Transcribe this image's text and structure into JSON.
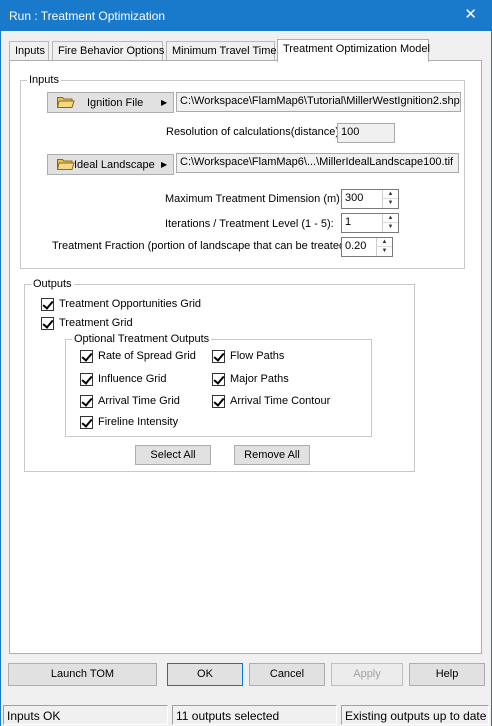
{
  "window": {
    "title": "Run : Treatment Optimization",
    "close_glyph": "✕"
  },
  "tabs": [
    {
      "label": "Inputs"
    },
    {
      "label": "Fire Behavior Options"
    },
    {
      "label": "Minimum Travel Time"
    },
    {
      "label": "Treatment Optimization Model"
    }
  ],
  "inputs": {
    "legend": "Inputs",
    "ignition_button": "Ignition File",
    "ignition_path": "C:\\Workspace\\FlamMap6\\Tutorial\\MillerWestIgnition2.shp",
    "resolution_label": "Resolution of calculations(distance):",
    "resolution_value": "100",
    "landscape_button": "Ideal Landscape",
    "landscape_path": "C:\\Workspace\\FlamMap6\\...\\MillerIdealLandscape100.tif",
    "max_dim_label": "Maximum Treatment Dimension (m):",
    "max_dim_value": "300",
    "iterations_label": "Iterations / Treatment Level (1 - 5):",
    "iterations_value": "1",
    "fraction_label": "Treatment Fraction (portion of landscape that can be treated):",
    "fraction_value": "0.20"
  },
  "outputs": {
    "legend": "Outputs",
    "opportunities": "Treatment Opportunities Grid",
    "treatment_grid": "Treatment Grid",
    "optional_legend": "Optional Treatment Outputs",
    "rate_of_spread": "Rate of Spread Grid",
    "influence": "Influence Grid",
    "arrival_time": "Arrival Time Grid",
    "fireline": "Fireline Intensity",
    "flow_paths": "Flow Paths",
    "major_paths": "Major Paths",
    "arrival_contour": "Arrival Time Contour",
    "select_all": "Select All",
    "remove_all": "Remove All"
  },
  "buttons": {
    "launch": "Launch TOM",
    "ok": "OK",
    "cancel": "Cancel",
    "apply": "Apply",
    "help": "Help"
  },
  "status": {
    "left": "Inputs OK",
    "middle": "11 outputs selected",
    "right": "Existing outputs up to date"
  },
  "icons": {
    "folder": "folder-open-icon",
    "arrow": "arrow-right-icon",
    "check": "checkmark"
  },
  "colors": {
    "titlebar": "#1979ca",
    "folder": "#e8c25a"
  }
}
